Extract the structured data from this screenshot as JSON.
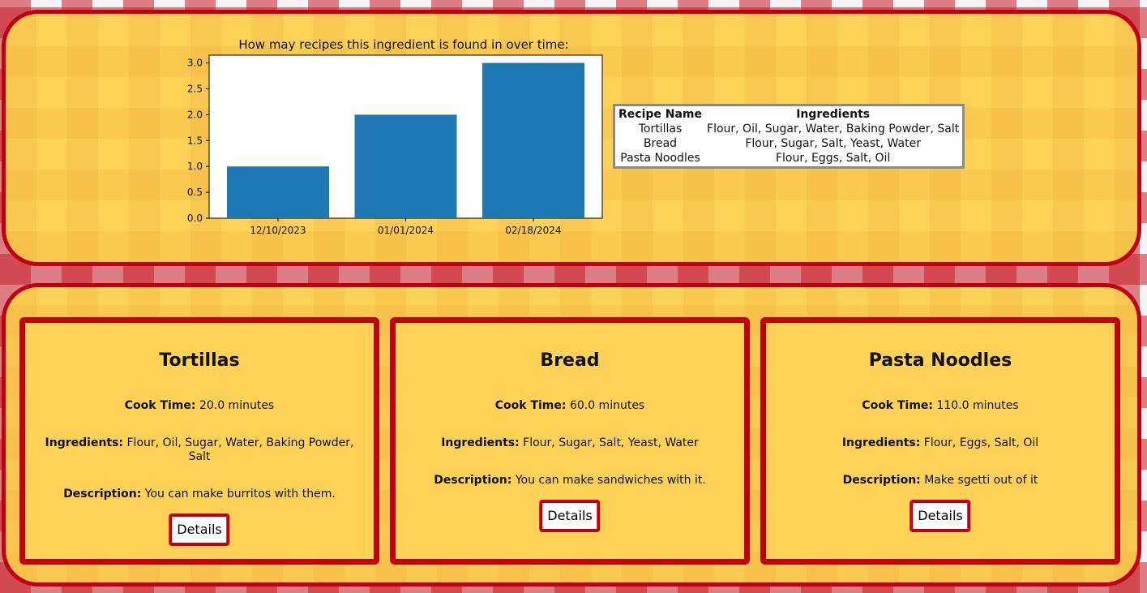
{
  "chart_data": {
    "type": "bar",
    "title": "How may recipes this ingredient is found in over time:",
    "categories": [
      "12/10/2023",
      "01/01/2024",
      "02/18/2024"
    ],
    "values": [
      1,
      2,
      3
    ],
    "ylim": [
      0,
      3.15
    ],
    "yticks": [
      "0.0",
      "0.5",
      "1.0",
      "1.5",
      "2.0",
      "2.5",
      "3.0"
    ],
    "bar_color": "#1f77b4",
    "xlabel": "",
    "ylabel": ""
  },
  "table": {
    "headers": [
      "Recipe Name",
      "Ingredients"
    ],
    "rows": [
      [
        "Tortillas",
        "Flour, Oil, Sugar, Water, Baking Powder, Salt"
      ],
      [
        "Bread",
        "Flour, Sugar, Salt, Yeast, Water"
      ],
      [
        "Pasta Noodles",
        "Flour, Eggs, Salt, Oil"
      ]
    ]
  },
  "cards": [
    {
      "title": "Tortillas",
      "cook_label": "Cook Time:",
      "cook_value": "20.0 minutes",
      "ingredients_label": "Ingredients:",
      "ingredients_value": "Flour, Oil, Sugar, Water, Baking Powder, Salt",
      "description_label": "Description:",
      "description_value": "You can make burritos with them.",
      "button_label": "Details"
    },
    {
      "title": "Bread",
      "cook_label": "Cook Time:",
      "cook_value": "60.0 minutes",
      "ingredients_label": "Ingredients:",
      "ingredients_value": "Flour, Sugar, Salt, Yeast, Water",
      "description_label": "Description:",
      "description_value": "You can make sandwiches with it.",
      "button_label": "Details"
    },
    {
      "title": "Pasta Noodles",
      "cook_label": "Cook Time:",
      "cook_value": "110.0 minutes",
      "ingredients_label": "Ingredients:",
      "ingredients_value": "Flour, Eggs, Salt, Oil",
      "description_label": "Description:",
      "description_value": "Make sgetti out of it",
      "button_label": "Details"
    }
  ],
  "colors": {
    "panel_bg": "#fdd257",
    "border_red": "#c00010",
    "table_border": "#8a8a8a"
  }
}
